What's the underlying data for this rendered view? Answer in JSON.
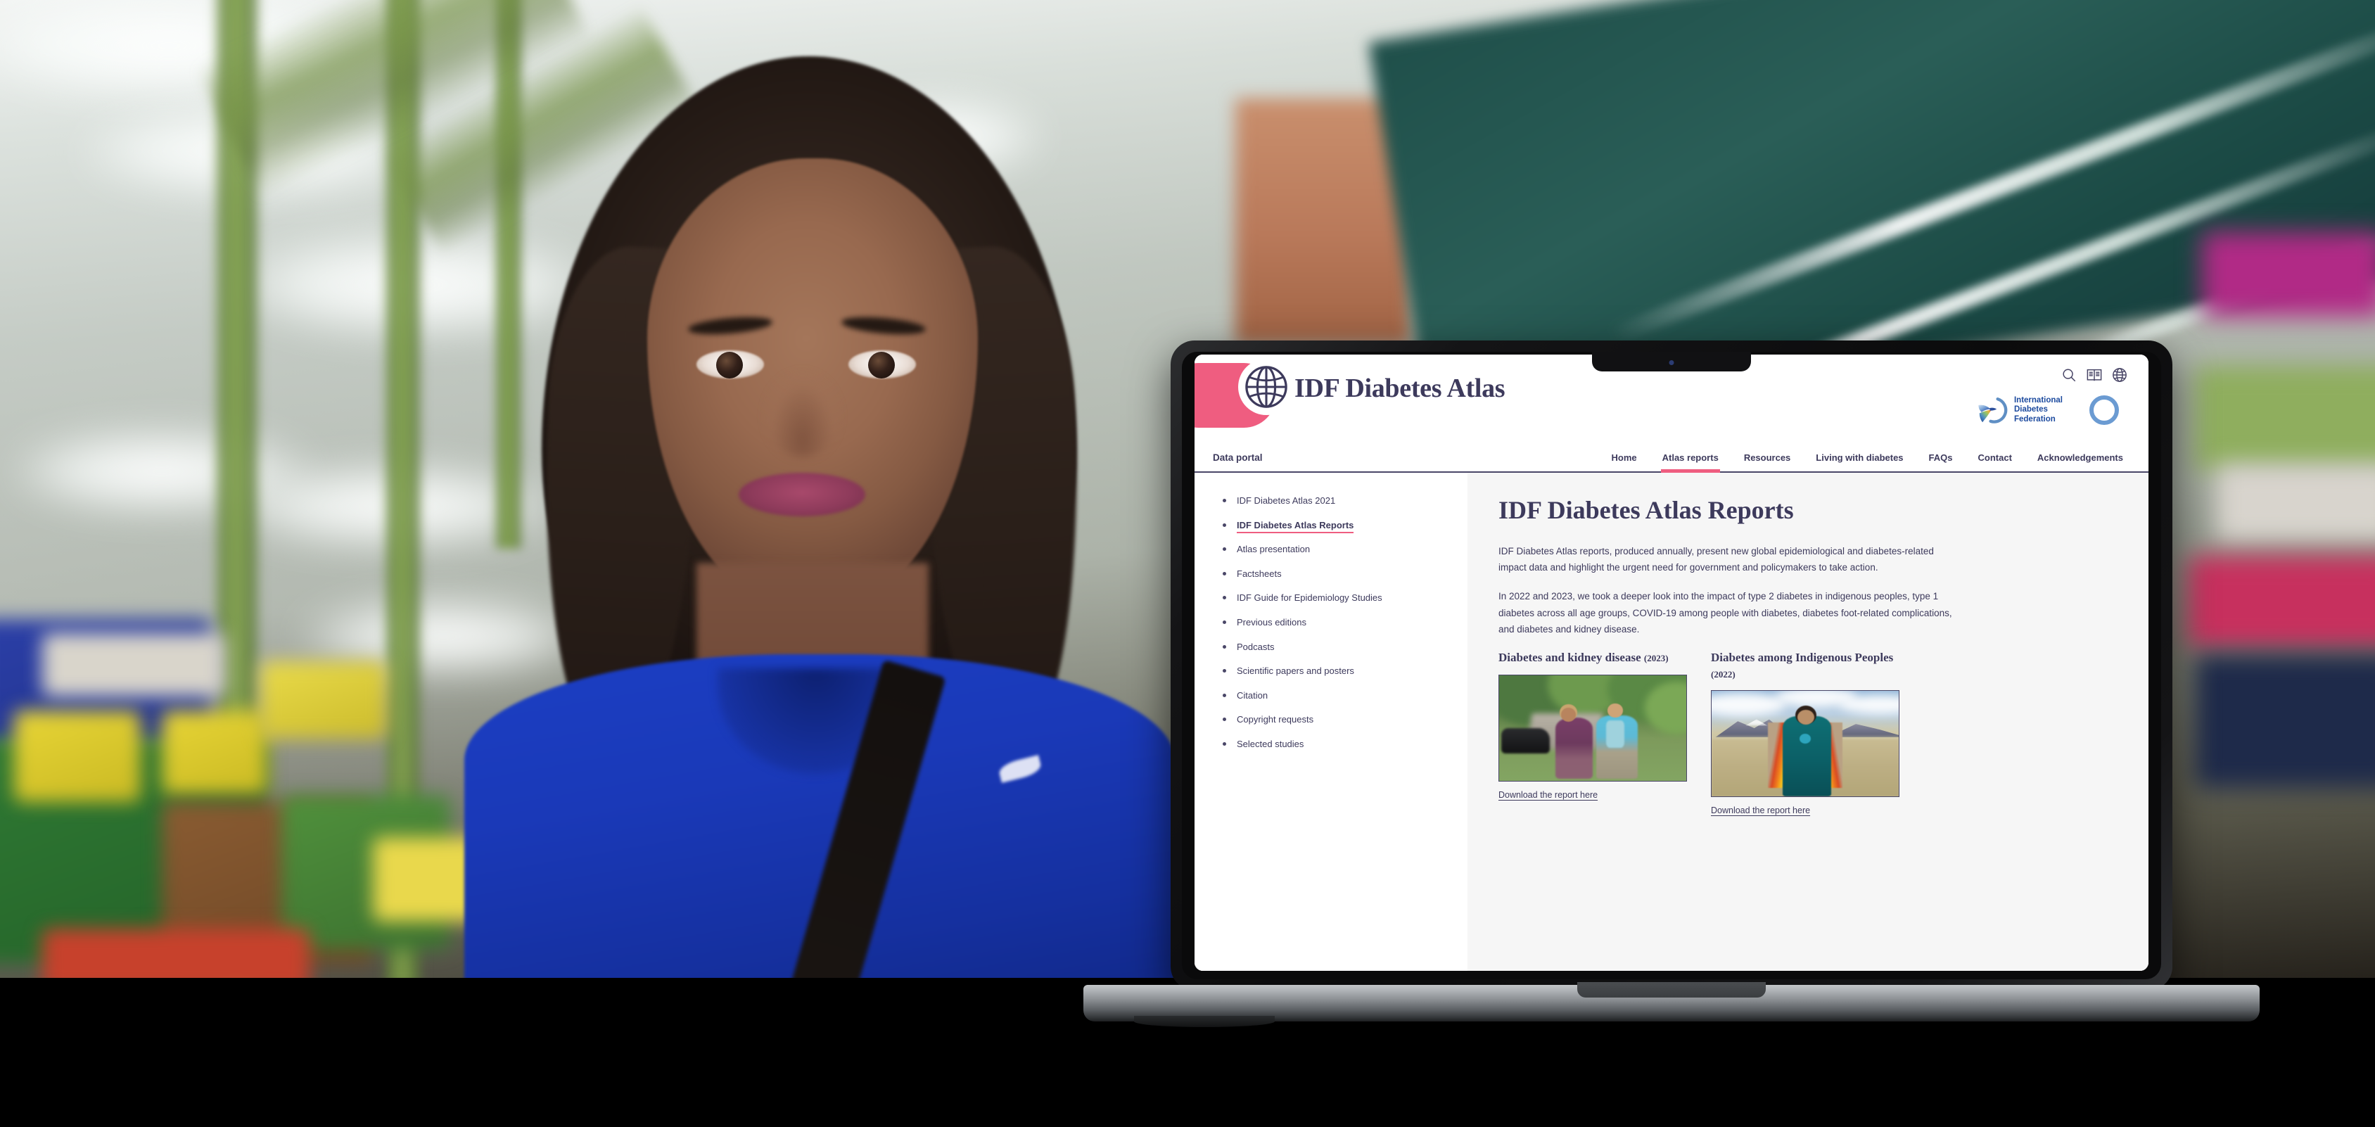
{
  "header": {
    "site_title": "IDF Diabetes Atlas",
    "logo_icon": "globe-icon",
    "icons": [
      {
        "name": "search-icon",
        "label": "Search"
      },
      {
        "name": "glossary-book-icon",
        "label": "Glossary"
      },
      {
        "name": "language-globe-icon",
        "label": "Language"
      }
    ],
    "partner_logo": {
      "name": "international-diabetes-federation-logo",
      "line1": "International",
      "line2": "Diabetes",
      "line3": "Federation"
    }
  },
  "nav": {
    "left_label": "Data portal",
    "items": [
      {
        "label": "Home",
        "active": false
      },
      {
        "label": "Atlas reports",
        "active": true
      },
      {
        "label": "Resources",
        "active": false
      },
      {
        "label": "Living with diabetes",
        "active": false
      },
      {
        "label": "FAQs",
        "active": false
      },
      {
        "label": "Contact",
        "active": false
      },
      {
        "label": "Acknowledgements",
        "active": false
      }
    ]
  },
  "sidebar": {
    "items": [
      {
        "label": "IDF Diabetes Atlas 2021",
        "current": false
      },
      {
        "label": "IDF Diabetes Atlas Reports",
        "current": true
      },
      {
        "label": "Atlas presentation",
        "current": false
      },
      {
        "label": "Factsheets",
        "current": false
      },
      {
        "label": "IDF Guide for Epidemiology Studies",
        "current": false
      },
      {
        "label": "Previous editions",
        "current": false
      },
      {
        "label": "Podcasts",
        "current": false
      },
      {
        "label": "Scientific papers and posters",
        "current": false
      },
      {
        "label": "Citation",
        "current": false
      },
      {
        "label": "Copyright requests",
        "current": false
      },
      {
        "label": "Selected studies",
        "current": false
      }
    ]
  },
  "main": {
    "title": "IDF Diabetes Atlas Reports",
    "paragraph1": "IDF Diabetes Atlas reports, produced annually, present new global epidemiological and diabetes-related impact data and highlight the urgent need for government and policymakers to take action.",
    "paragraph2": "In 2022 and 2023, we took a deeper look into the impact of type 2 diabetes in indigenous peoples, type 1 diabetes across all age groups, COVID-19 among people with diabetes, diabetes foot-related complications, and diabetes and kidney disease.",
    "cards": [
      {
        "title": "Diabetes and kidney disease",
        "year": "(2023)",
        "image_name": "couple-walking-outdoors-photo",
        "download_label": "Download the report here"
      },
      {
        "title": "Diabetes among Indigenous Peoples",
        "year": "(2022)",
        "image_name": "indigenous-girl-in-shawl-photo",
        "download_label": "Download the report here"
      }
    ]
  },
  "colors": {
    "accent_pink": "#ef5d80",
    "ink_purple": "#3d3a5c",
    "idf_blue": "#1c4a9e",
    "content_bg": "#f6f6f6"
  },
  "scene": {
    "device": "laptop",
    "backdrop_name": "blurred-food-bank-warehouse-photo",
    "subject_name": "woman-in-blue-shirt-portrait"
  }
}
